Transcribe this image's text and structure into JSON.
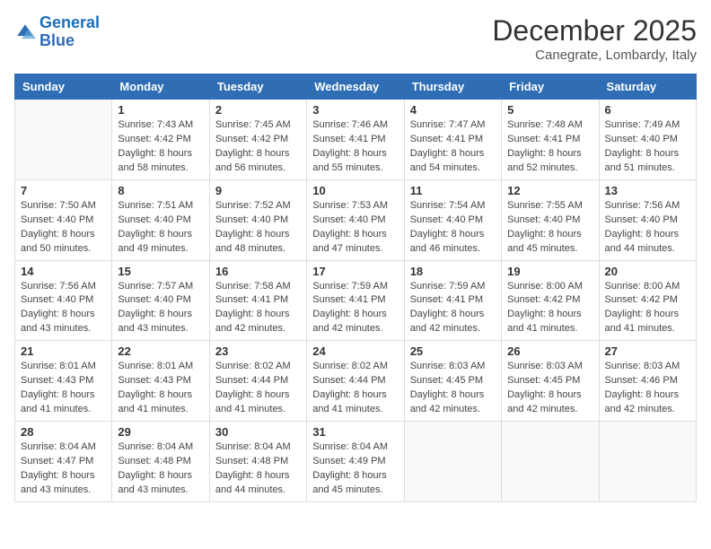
{
  "logo": {
    "line1": "General",
    "line2": "Blue"
  },
  "title": "December 2025",
  "location": "Canegrate, Lombardy, Italy",
  "days_header": [
    "Sunday",
    "Monday",
    "Tuesday",
    "Wednesday",
    "Thursday",
    "Friday",
    "Saturday"
  ],
  "weeks": [
    [
      {
        "day": "",
        "sunrise": "",
        "sunset": "",
        "daylight": ""
      },
      {
        "day": "1",
        "sunrise": "Sunrise: 7:43 AM",
        "sunset": "Sunset: 4:42 PM",
        "daylight": "Daylight: 8 hours and 58 minutes."
      },
      {
        "day": "2",
        "sunrise": "Sunrise: 7:45 AM",
        "sunset": "Sunset: 4:42 PM",
        "daylight": "Daylight: 8 hours and 56 minutes."
      },
      {
        "day": "3",
        "sunrise": "Sunrise: 7:46 AM",
        "sunset": "Sunset: 4:41 PM",
        "daylight": "Daylight: 8 hours and 55 minutes."
      },
      {
        "day": "4",
        "sunrise": "Sunrise: 7:47 AM",
        "sunset": "Sunset: 4:41 PM",
        "daylight": "Daylight: 8 hours and 54 minutes."
      },
      {
        "day": "5",
        "sunrise": "Sunrise: 7:48 AM",
        "sunset": "Sunset: 4:41 PM",
        "daylight": "Daylight: 8 hours and 52 minutes."
      },
      {
        "day": "6",
        "sunrise": "Sunrise: 7:49 AM",
        "sunset": "Sunset: 4:40 PM",
        "daylight": "Daylight: 8 hours and 51 minutes."
      }
    ],
    [
      {
        "day": "7",
        "sunrise": "Sunrise: 7:50 AM",
        "sunset": "Sunset: 4:40 PM",
        "daylight": "Daylight: 8 hours and 50 minutes."
      },
      {
        "day": "8",
        "sunrise": "Sunrise: 7:51 AM",
        "sunset": "Sunset: 4:40 PM",
        "daylight": "Daylight: 8 hours and 49 minutes."
      },
      {
        "day": "9",
        "sunrise": "Sunrise: 7:52 AM",
        "sunset": "Sunset: 4:40 PM",
        "daylight": "Daylight: 8 hours and 48 minutes."
      },
      {
        "day": "10",
        "sunrise": "Sunrise: 7:53 AM",
        "sunset": "Sunset: 4:40 PM",
        "daylight": "Daylight: 8 hours and 47 minutes."
      },
      {
        "day": "11",
        "sunrise": "Sunrise: 7:54 AM",
        "sunset": "Sunset: 4:40 PM",
        "daylight": "Daylight: 8 hours and 46 minutes."
      },
      {
        "day": "12",
        "sunrise": "Sunrise: 7:55 AM",
        "sunset": "Sunset: 4:40 PM",
        "daylight": "Daylight: 8 hours and 45 minutes."
      },
      {
        "day": "13",
        "sunrise": "Sunrise: 7:56 AM",
        "sunset": "Sunset: 4:40 PM",
        "daylight": "Daylight: 8 hours and 44 minutes."
      }
    ],
    [
      {
        "day": "14",
        "sunrise": "Sunrise: 7:56 AM",
        "sunset": "Sunset: 4:40 PM",
        "daylight": "Daylight: 8 hours and 43 minutes."
      },
      {
        "day": "15",
        "sunrise": "Sunrise: 7:57 AM",
        "sunset": "Sunset: 4:40 PM",
        "daylight": "Daylight: 8 hours and 43 minutes."
      },
      {
        "day": "16",
        "sunrise": "Sunrise: 7:58 AM",
        "sunset": "Sunset: 4:41 PM",
        "daylight": "Daylight: 8 hours and 42 minutes."
      },
      {
        "day": "17",
        "sunrise": "Sunrise: 7:59 AM",
        "sunset": "Sunset: 4:41 PM",
        "daylight": "Daylight: 8 hours and 42 minutes."
      },
      {
        "day": "18",
        "sunrise": "Sunrise: 7:59 AM",
        "sunset": "Sunset: 4:41 PM",
        "daylight": "Daylight: 8 hours and 42 minutes."
      },
      {
        "day": "19",
        "sunrise": "Sunrise: 8:00 AM",
        "sunset": "Sunset: 4:42 PM",
        "daylight": "Daylight: 8 hours and 41 minutes."
      },
      {
        "day": "20",
        "sunrise": "Sunrise: 8:00 AM",
        "sunset": "Sunset: 4:42 PM",
        "daylight": "Daylight: 8 hours and 41 minutes."
      }
    ],
    [
      {
        "day": "21",
        "sunrise": "Sunrise: 8:01 AM",
        "sunset": "Sunset: 4:43 PM",
        "daylight": "Daylight: 8 hours and 41 minutes."
      },
      {
        "day": "22",
        "sunrise": "Sunrise: 8:01 AM",
        "sunset": "Sunset: 4:43 PM",
        "daylight": "Daylight: 8 hours and 41 minutes."
      },
      {
        "day": "23",
        "sunrise": "Sunrise: 8:02 AM",
        "sunset": "Sunset: 4:44 PM",
        "daylight": "Daylight: 8 hours and 41 minutes."
      },
      {
        "day": "24",
        "sunrise": "Sunrise: 8:02 AM",
        "sunset": "Sunset: 4:44 PM",
        "daylight": "Daylight: 8 hours and 41 minutes."
      },
      {
        "day": "25",
        "sunrise": "Sunrise: 8:03 AM",
        "sunset": "Sunset: 4:45 PM",
        "daylight": "Daylight: 8 hours and 42 minutes."
      },
      {
        "day": "26",
        "sunrise": "Sunrise: 8:03 AM",
        "sunset": "Sunset: 4:45 PM",
        "daylight": "Daylight: 8 hours and 42 minutes."
      },
      {
        "day": "27",
        "sunrise": "Sunrise: 8:03 AM",
        "sunset": "Sunset: 4:46 PM",
        "daylight": "Daylight: 8 hours and 42 minutes."
      }
    ],
    [
      {
        "day": "28",
        "sunrise": "Sunrise: 8:04 AM",
        "sunset": "Sunset: 4:47 PM",
        "daylight": "Daylight: 8 hours and 43 minutes."
      },
      {
        "day": "29",
        "sunrise": "Sunrise: 8:04 AM",
        "sunset": "Sunset: 4:48 PM",
        "daylight": "Daylight: 8 hours and 43 minutes."
      },
      {
        "day": "30",
        "sunrise": "Sunrise: 8:04 AM",
        "sunset": "Sunset: 4:48 PM",
        "daylight": "Daylight: 8 hours and 44 minutes."
      },
      {
        "day": "31",
        "sunrise": "Sunrise: 8:04 AM",
        "sunset": "Sunset: 4:49 PM",
        "daylight": "Daylight: 8 hours and 45 minutes."
      },
      {
        "day": "",
        "sunrise": "",
        "sunset": "",
        "daylight": ""
      },
      {
        "day": "",
        "sunrise": "",
        "sunset": "",
        "daylight": ""
      },
      {
        "day": "",
        "sunrise": "",
        "sunset": "",
        "daylight": ""
      }
    ]
  ]
}
